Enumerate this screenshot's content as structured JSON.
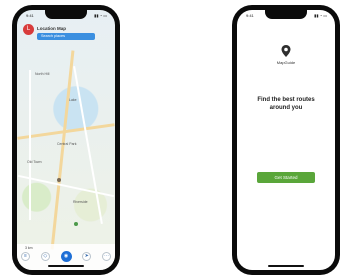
{
  "left_phone": {
    "status": {
      "time": "9:41",
      "indicators": "▮▮ ◔ ▭"
    },
    "map": {
      "avatar_initial": "L",
      "title": "Location Map",
      "search_placeholder": "Search places",
      "labels": [
        "Central Park",
        "Lake",
        "Old Town",
        "Riverside",
        "North Hill"
      ],
      "bottom_caption": "3 km"
    },
    "controls": [
      {
        "name": "layers-icon",
        "glyph": "≡"
      },
      {
        "name": "filter-icon",
        "glyph": "◇"
      },
      {
        "name": "locate-icon",
        "glyph": "◉"
      },
      {
        "name": "compass-icon",
        "glyph": "➤"
      },
      {
        "name": "menu-icon",
        "glyph": "⋯"
      }
    ]
  },
  "right_phone": {
    "status": {
      "time": "9:41",
      "indicators": "▮▮ ◔ ▭"
    },
    "logo_icon": "location-pin-icon",
    "app_name": "MapGuide",
    "headline": "Find the best routes around you",
    "cta_label": "Get Started"
  },
  "colors": {
    "map_accent": "#3b8fe0",
    "cta_green": "#5aa63a",
    "avatar_red": "#d83b3b"
  }
}
